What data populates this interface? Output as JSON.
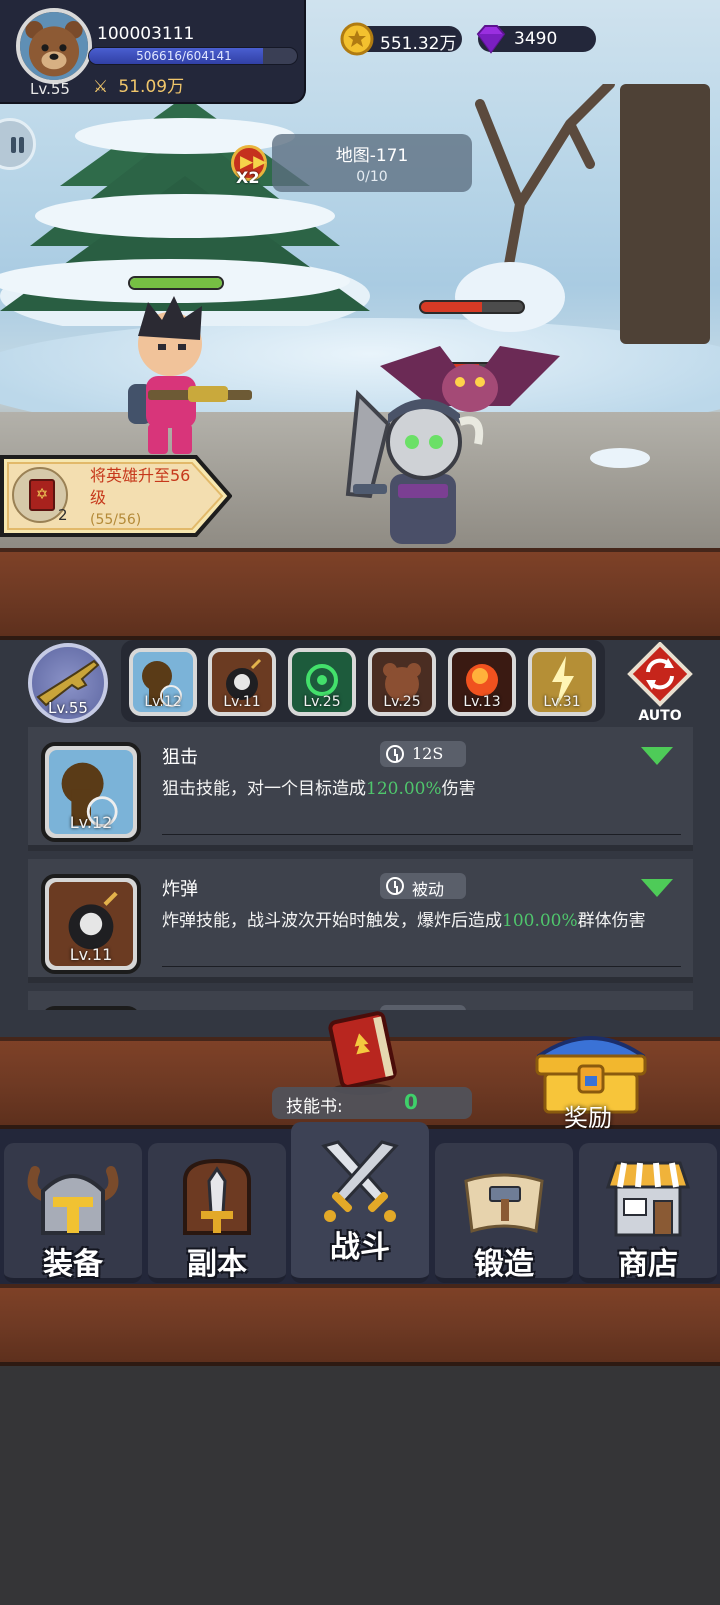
{
  "player": {
    "id": "100003111",
    "level": "Lv.55",
    "exp_text": "506616/604141",
    "exp_ratio": 0.8386,
    "power": "51.09万"
  },
  "currency": {
    "coins": "551.32万",
    "gems": "3490"
  },
  "battle": {
    "speed": "X2",
    "map_title": "地图-171",
    "map_progress": "0/10",
    "hero_hp_ratio": 1.0,
    "enemy1_hp_ratio": 0.6,
    "enemy2_hp_ratio": 0.6
  },
  "quest": {
    "text": "将英雄升至56级",
    "count": "2",
    "progress": "(55/56)"
  },
  "weapon": {
    "level": "Lv.55"
  },
  "skill_slots": [
    {
      "level": "Lv.12",
      "icon": "sniper-icon"
    },
    {
      "level": "Lv.11",
      "icon": "bomb-icon"
    },
    {
      "level": "Lv.25",
      "icon": "poison-icon"
    },
    {
      "level": "Lv.25",
      "icon": "bear-icon"
    },
    {
      "level": "Lv.13",
      "icon": "fireball-icon"
    },
    {
      "level": "Lv.31",
      "icon": "lightning-icon"
    }
  ],
  "auto_label": "AUTO",
  "skills": [
    {
      "name": "狙击",
      "level": "Lv.12",
      "cooldown": "12S",
      "desc_before": "狙击技能，对一个目标造成",
      "desc_value": "120.00%",
      "desc_after": "伤害"
    },
    {
      "name": "炸弹",
      "level": "Lv.11",
      "cooldown": "被动",
      "desc_before": "炸弹技能，战斗波次开始时触发，爆炸后造成",
      "desc_value": "100.00%",
      "desc_after": "群体伤害"
    }
  ],
  "skill_book": {
    "label": "技能书:",
    "count": "0"
  },
  "reward": {
    "label": "奖励"
  },
  "nav": [
    {
      "label": "装备",
      "icon": "helmet-icon"
    },
    {
      "label": "副本",
      "icon": "dungeon-sword-icon"
    },
    {
      "label": "战斗",
      "icon": "crossed-swords-icon"
    },
    {
      "label": "锻造",
      "icon": "forge-scroll-icon"
    },
    {
      "label": "商店",
      "icon": "shop-icon"
    }
  ],
  "colors": {
    "wood": "#6f3a24",
    "panel": "#23273a",
    "highlight_green": "#4fc56c",
    "quest_red": "#c6381b"
  }
}
